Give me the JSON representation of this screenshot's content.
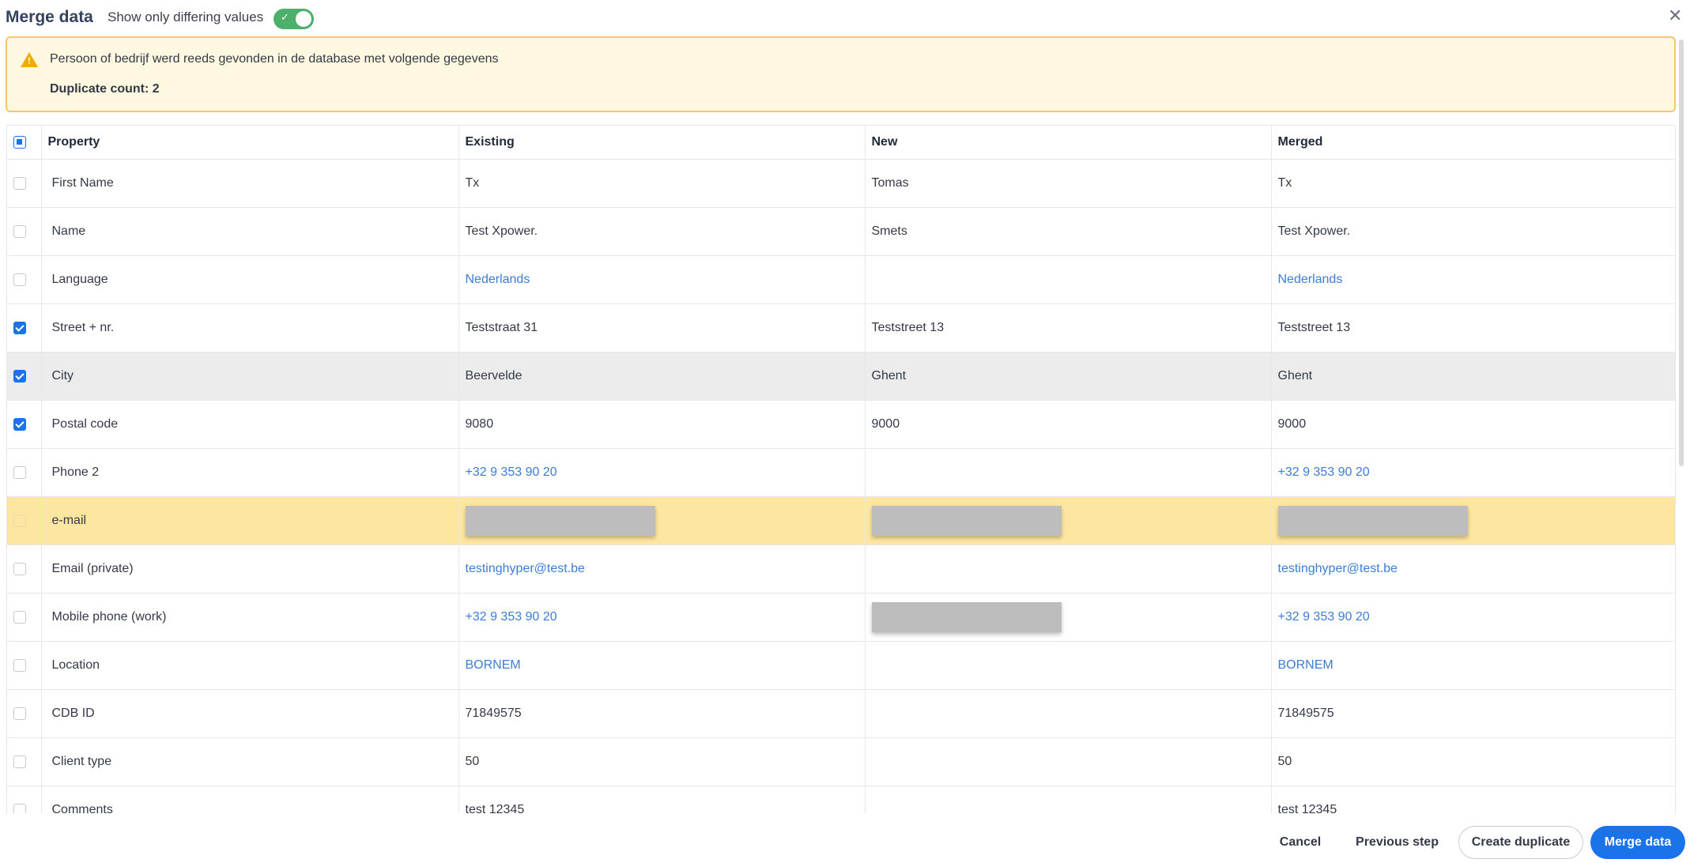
{
  "dialog": {
    "title": "Merge data",
    "toggle_label": "Show only differing values",
    "toggle_on": true
  },
  "alert": {
    "message": "Persoon of bedrijf werd reeds gevonden in de database met volgende gegevens",
    "count_label": "Duplicate count: 2"
  },
  "table": {
    "headers": [
      "Property",
      "Existing",
      "New",
      "Merged"
    ],
    "rows": [
      {
        "property": "First Name",
        "existing": "Tx",
        "new": "Tomas",
        "merged": "Tx",
        "checked": false
      },
      {
        "property": "Name",
        "existing": "Test Xpower.",
        "new": "Smets",
        "merged": "Test Xpower.",
        "checked": false
      },
      {
        "property": "Language",
        "existing": "Nederlands",
        "new": "",
        "merged": "Nederlands",
        "checked": false
      },
      {
        "property": "Street + nr.",
        "existing": "Teststraat 31",
        "new": "Teststreet 13",
        "merged": "Teststreet 13",
        "checked": true
      },
      {
        "property": "City",
        "existing": "Beervelde",
        "new": "Ghent",
        "merged": "Ghent",
        "checked": true
      },
      {
        "property": "Postal code",
        "existing": "9080",
        "new": "9000",
        "merged": "9000",
        "checked": true
      },
      {
        "property": "Phone 2",
        "existing": "+32 9 353 90 20",
        "new": "",
        "merged": "+32 9 353 90 20",
        "checked": false
      },
      {
        "property": "e-mail",
        "existing": "",
        "new": "",
        "merged": "",
        "checked": false
      },
      {
        "property": "Email (private)",
        "existing": "testinghyper@test.be",
        "new": "",
        "merged": "testinghyper@test.be",
        "checked": false
      },
      {
        "property": "Mobile phone (work)",
        "existing": "+32 9 353 90 20",
        "new": "",
        "merged": "+32 9 353 90 20",
        "checked": false
      },
      {
        "property": "Location",
        "existing": "BORNEM",
        "new": "",
        "merged": "BORNEM",
        "checked": false
      },
      {
        "property": "CDB ID",
        "existing": "71849575",
        "new": "",
        "merged": "71849575",
        "checked": false
      },
      {
        "property": "Client type",
        "existing": "50",
        "new": "",
        "merged": "50",
        "checked": false
      },
      {
        "property": "Comments",
        "existing": "test 12345",
        "new": "",
        "merged": "test 12345",
        "checked": false
      }
    ]
  },
  "footer": {
    "cancel": "Cancel",
    "previous": "Previous step",
    "create_duplicate": "Create duplicate",
    "merge": "Merge data"
  },
  "colors": {
    "accent": "#1a73e8",
    "link": "#3b7dd8",
    "toggle": "#4caf6a",
    "alert_bg": "#fff8e1",
    "alert_border": "#f4c76b",
    "highlight_row": "#fde7a0"
  }
}
